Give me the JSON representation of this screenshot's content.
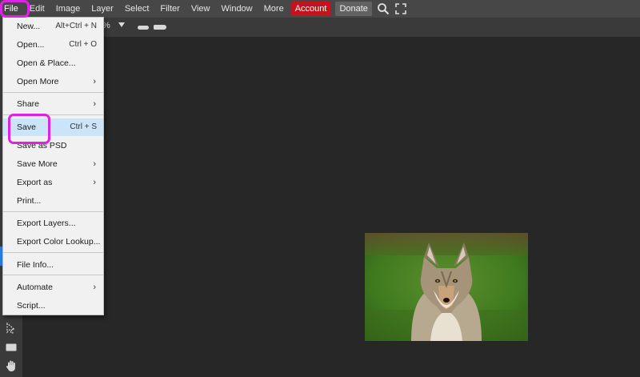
{
  "menubar": {
    "items": [
      "File",
      "Edit",
      "Image",
      "Layer",
      "Select",
      "Filter",
      "View",
      "Window",
      "More"
    ],
    "account_label": "Account",
    "donate_label": "Donate",
    "icons": [
      "search-icon",
      "fullscreen-icon"
    ]
  },
  "optionsbar": {
    "zoom_suffix": "%"
  },
  "file_menu": {
    "items": [
      {
        "label": "New...",
        "shortcut": "Alt+Ctrl + N"
      },
      {
        "label": "Open...",
        "shortcut": "Ctrl + O"
      },
      {
        "label": "Open & Place...",
        "shortcut": ""
      },
      {
        "label": "Open More",
        "submenu": true
      },
      {
        "label": "Share",
        "submenu": true
      },
      {
        "label": "Save",
        "shortcut": "Ctrl + S",
        "highlighted": true
      },
      {
        "label": "Save as PSD",
        "shortcut": ""
      },
      {
        "label": "Save More",
        "submenu": true
      },
      {
        "label": "Export as",
        "submenu": true
      },
      {
        "label": "Print...",
        "shortcut": ""
      },
      {
        "label": "Export Layers...",
        "shortcut": ""
      },
      {
        "label": "Export Color Lookup...",
        "shortcut": ""
      },
      {
        "label": "File Info...",
        "shortcut": ""
      },
      {
        "label": "Automate",
        "submenu": true
      },
      {
        "label": "Script...",
        "shortcut": ""
      }
    ]
  },
  "canvas": {
    "image_subject": "coyote"
  },
  "colors": {
    "menubar_bg": "#474747",
    "workspace_bg": "#272727",
    "account_red": "#c4141b",
    "highlight_blue": "#cce4f7",
    "annotation_magenta": "#e020e6"
  }
}
